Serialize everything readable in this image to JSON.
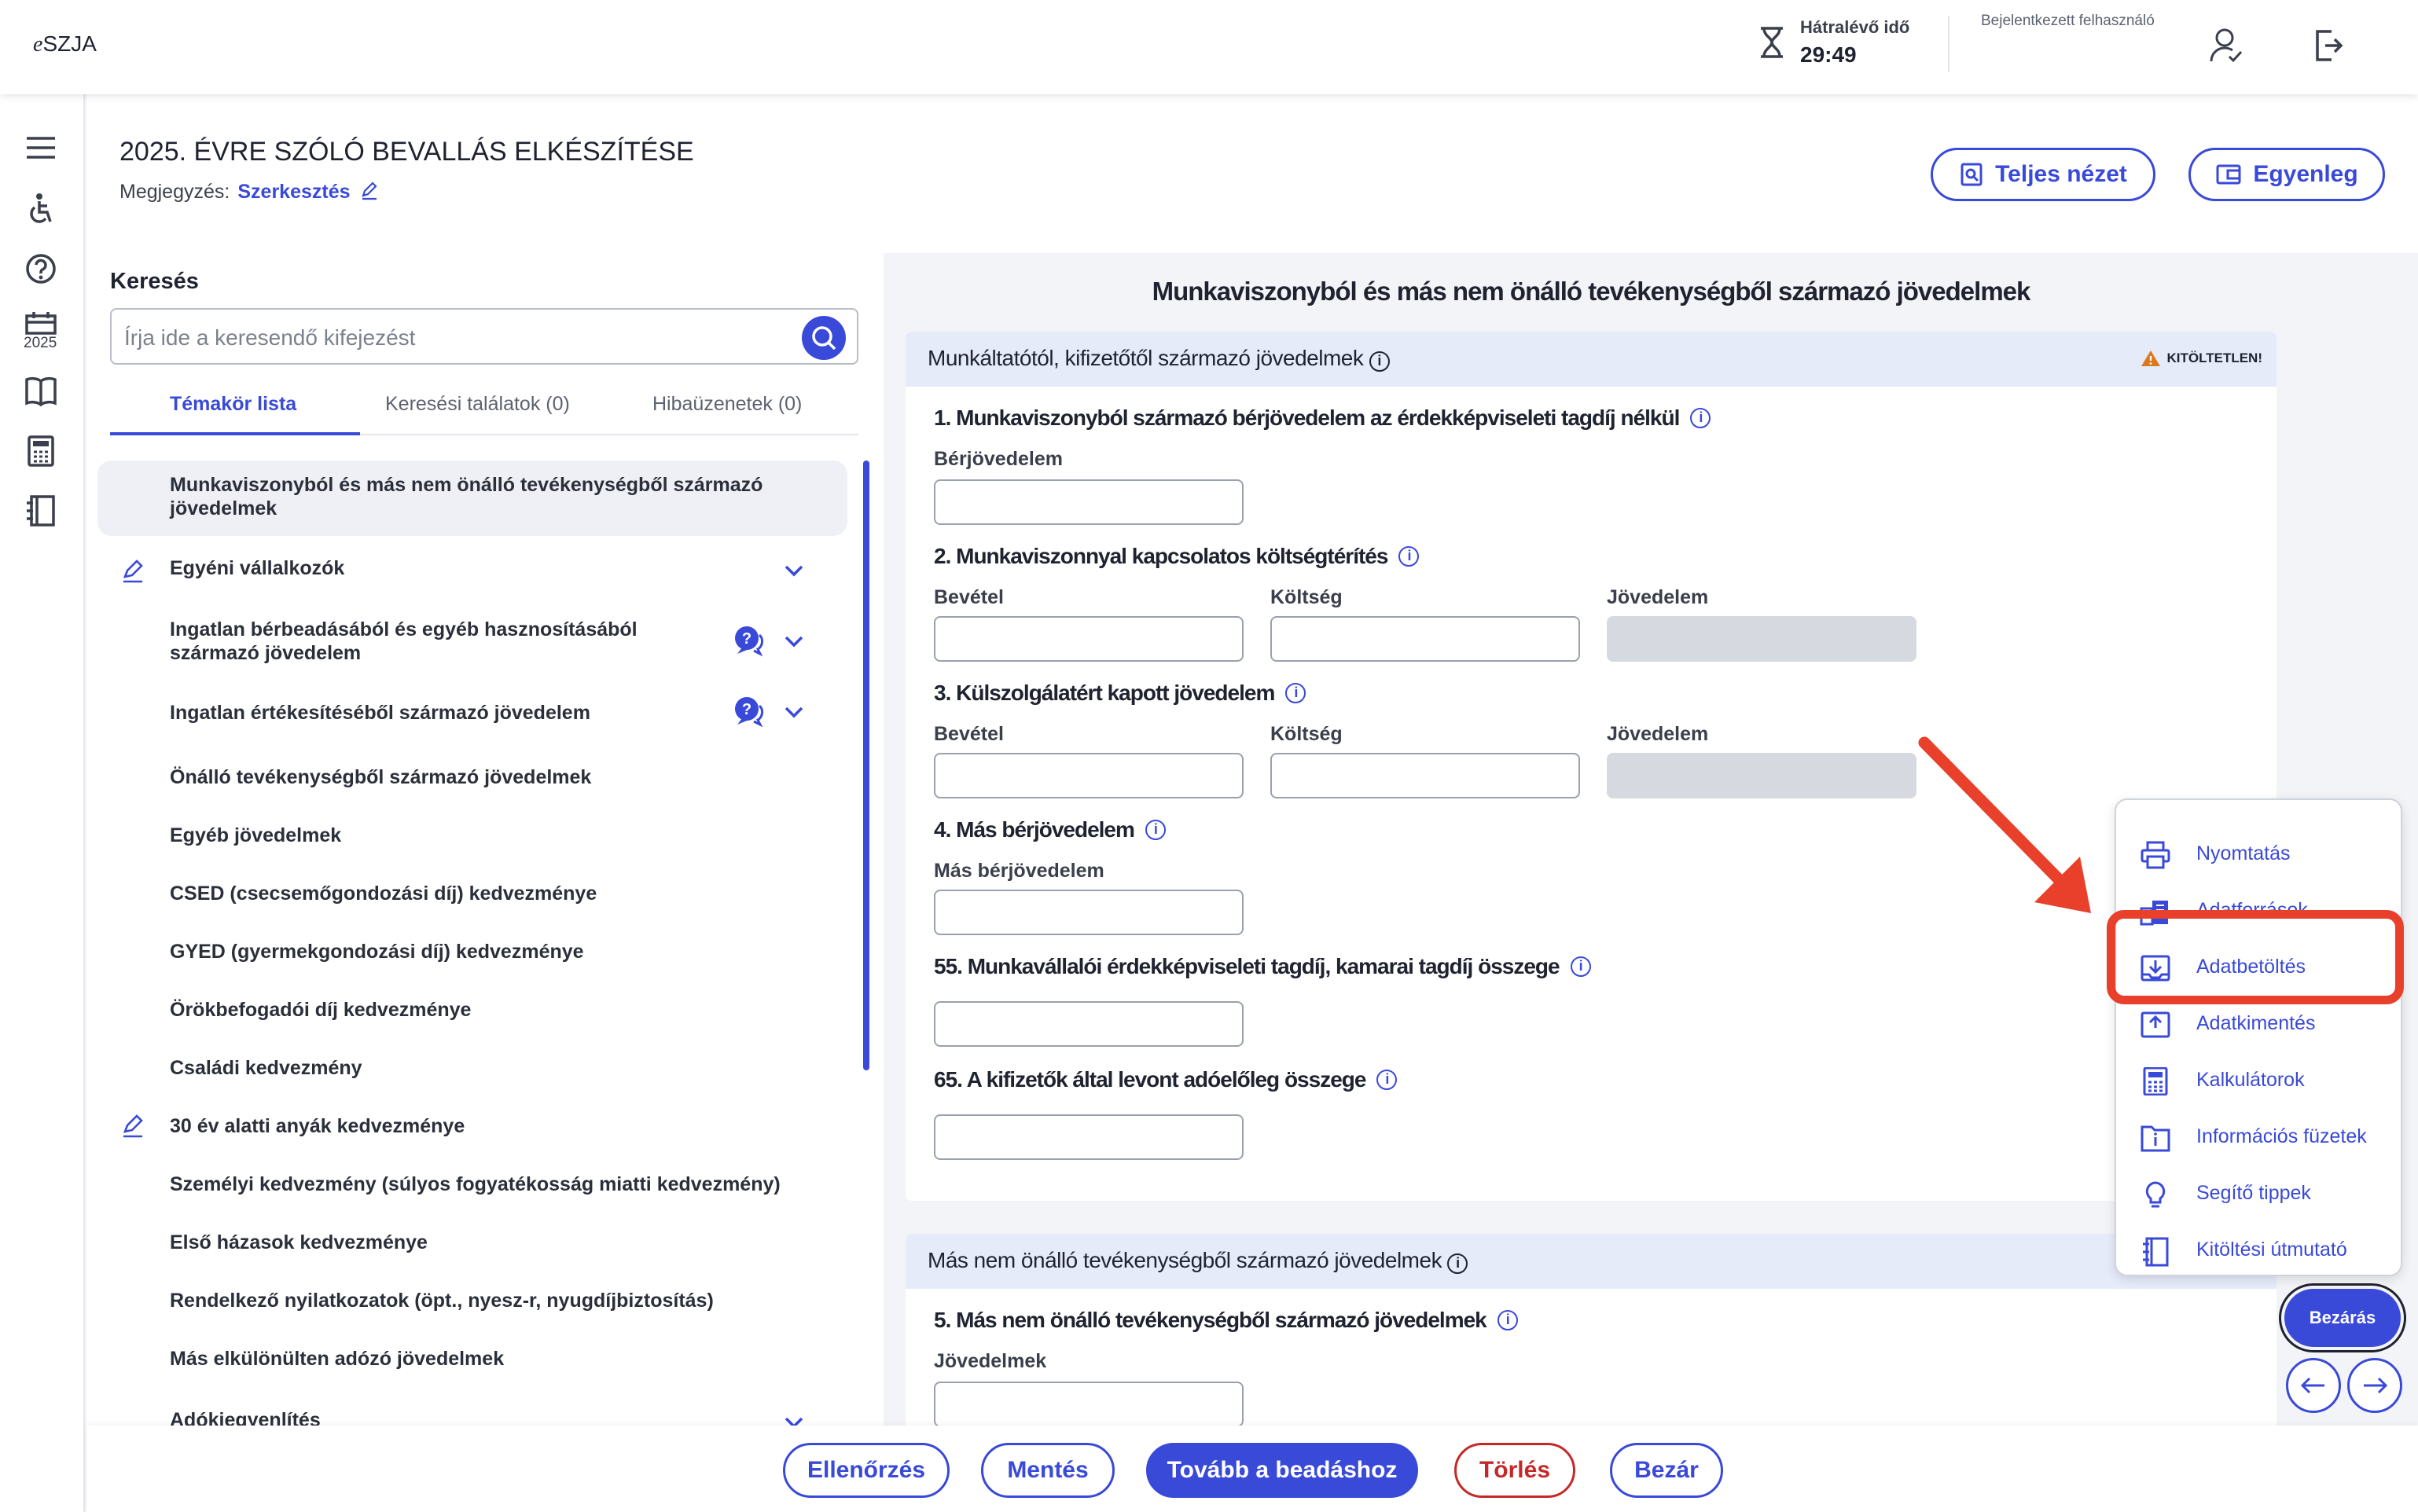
{
  "app": {
    "logo_prefix": "e",
    "logo_suffix": "SZJA"
  },
  "header": {
    "timer_label": "Hátralévő idő",
    "timer_value": "29:49",
    "user_label": "Bejelentkezett felhasználó"
  },
  "sidebar": {
    "calendar_year": "2025"
  },
  "page": {
    "title": "2025. ÉVRE SZÓLÓ BEVALLÁS ELKÉSZÍTÉSE",
    "note_label": "Megjegyzés:",
    "note_link": "Szerkesztés",
    "full_view_btn": "Teljes nézet",
    "balance_btn": "Egyenleg"
  },
  "search": {
    "heading": "Keresés",
    "placeholder": "Írja ide a keresendő kifejezést",
    "tabs": [
      "Témakör lista",
      "Keresési találatok (0)",
      "Hibaüzenetek (0)"
    ]
  },
  "nav": {
    "items": [
      "Munkaviszonyból és más nem önálló tevékenységből származó jövedelmek",
      "Egyéni vállalkozók",
      "Ingatlan bérbeadásából és egyéb hasznosításából származó jövedelem",
      "Ingatlan értékesítéséből származó jövedelem",
      "Önálló tevékenységből származó jövedelmek",
      "Egyéb jövedelmek",
      "CSED (csecsemőgondozási díj) kedvezménye",
      "GYED (gyermekgondozási díj) kedvezménye",
      "Örökbefogadói díj kedvezménye",
      "Családi kedvezmény",
      "30 év alatti anyák kedvezménye",
      "Személyi kedvezmény (súlyos fogyatékosság miatti kedvezmény)",
      "Első házasok kedvezménye",
      "Rendelkező nyilatkozatok (öpt., nyesz-r, nyugdíjbiztosítás)",
      "Más elkülönülten adózó jövedelmek",
      "Adókiegyenlítés"
    ]
  },
  "form": {
    "title": "Munkaviszonyból és más nem önálló tevékenységből származó jövedelmek",
    "section1_title": "Munkáltatótól, kifizetőtől származó jövedelmek",
    "section1_status": "KITÖLTETLEN!",
    "q1": "1. Munkaviszonyból származó bérjövedelem az érdekképviseleti tagdíj nélkül",
    "q1_field": "Bérjövedelem",
    "q2": "2. Munkaviszonnyal kapcsolatos költségtérítés",
    "q3": "3. Külszolgálatért kapott jövedelem",
    "label_income": "Bevétel",
    "label_cost": "Költség",
    "label_profit": "Jövedelem",
    "q4": "4. Más bérjövedelem",
    "q4_field": "Más bérjövedelem",
    "q55": "55. Munkavállalói érdekképviseleti tagdíj, kamarai tagdíj összege",
    "q65": "65. A kifizetők által levont adóelőleg összege",
    "section2_title": "Más nem önálló tevékenységből származó jövedelmek",
    "q5": "5. Más nem önálló tevékenységből származó jövedelmek",
    "q5_field": "Jövedelmek"
  },
  "menu": {
    "items": [
      "Nyomtatás",
      "Adatforrások",
      "Adatbetöltés",
      "Adatkimentés",
      "Kalkulátorok",
      "Információs füzetek",
      "Segítő tippek",
      "Kitöltési útmutató"
    ],
    "close": "Bezárás"
  },
  "bottom": {
    "check": "Ellenőrzés",
    "save": "Mentés",
    "submit": "Tovább a beadáshoz",
    "delete": "Törlés",
    "close": "Bezár"
  },
  "colors": {
    "accent": "#3949d8",
    "danger": "#c62828",
    "highlight": "#e8402a"
  }
}
